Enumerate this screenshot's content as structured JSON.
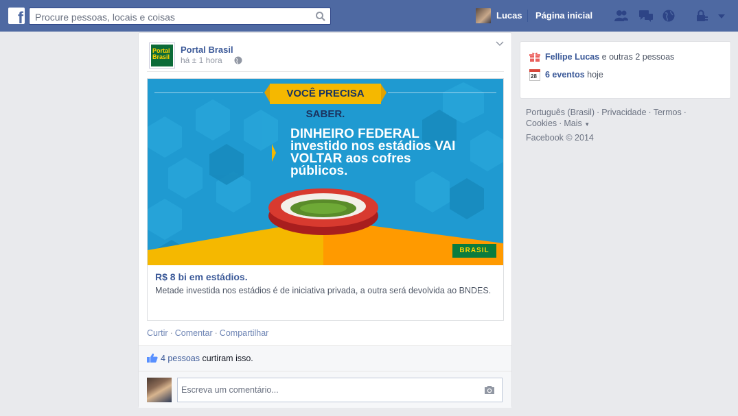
{
  "topbar": {
    "logo": "f",
    "search_placeholder": "Procure pessoas, locais e coisas",
    "user_name": "Lucas",
    "home_label": "Página inicial",
    "icons": [
      "friend-requests-icon",
      "messages-icon",
      "notifications-globe-icon",
      "privacy-lock-icon",
      "account-menu-chevron-icon"
    ]
  },
  "post": {
    "page_logo_text": "Portal Brasil",
    "page_name": "Portal Brasil",
    "timestamp": "há ± 1 hora",
    "image": {
      "banner_text": "VOCÊ PRECISA SABER.",
      "headline": "DINHEIRO FEDERAL investido nos estádios VAI VOLTAR aos cofres públicos.",
      "brand": "BRASIL"
    },
    "link_title": "R$ 8 bi em estádios.",
    "link_description": "Metade investida nos estádios é de iniciativa privada, a outra será devolvida ao BNDES.",
    "actions": [
      "Curtir",
      "Comentar",
      "Compartilhar"
    ],
    "likes_count": "4 pessoas",
    "likes_suffix": " curtiram isso.",
    "comment_placeholder": "Escreva um comentário..."
  },
  "sidebar": {
    "birthday_name": "Fellipe Lucas",
    "birthday_rest": " e outras 2 pessoas",
    "calendar_day": "28",
    "events_link": "6 eventos",
    "events_rest": " hoje",
    "footer_links": [
      "Português (Brasil)",
      "Privacidade",
      "Termos",
      "Cookies",
      "Mais"
    ],
    "copyright": "Facebook © 2014"
  },
  "colors": {
    "brand_blue": "#4e69a2",
    "link_blue": "#3b5998",
    "background": "#e9eaed",
    "promo_blue": "#1f9ad1",
    "promo_yellow": "#f5b800"
  }
}
